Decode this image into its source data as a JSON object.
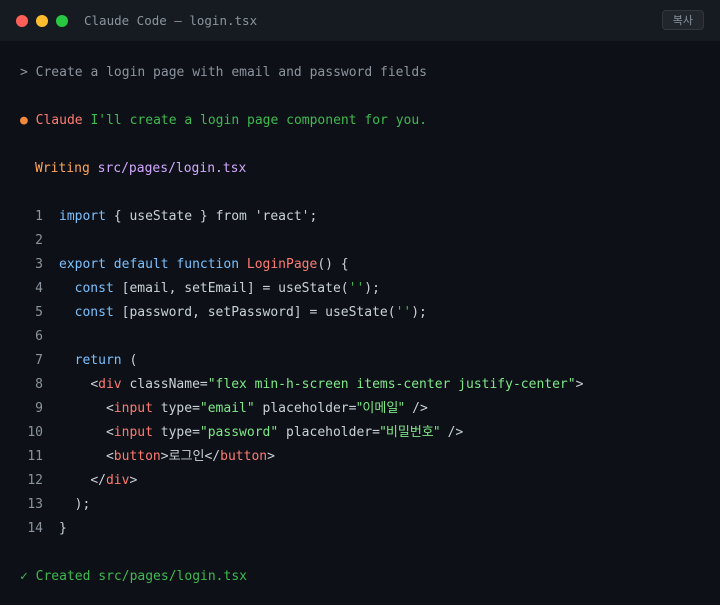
{
  "window": {
    "title": "Claude Code — login.tsx",
    "copy_label": "복사"
  },
  "conversation": {
    "prompt_caret": ">",
    "prompt_text": "Create a login page with email and password fields",
    "claude_bullet": "●",
    "claude_name": "Claude",
    "claude_message": "I'll create a login page component for you.",
    "writing_verb": "Writing",
    "writing_path": "src/pages/login.tsx",
    "created_check": "✓",
    "created_text": "Created src/pages/login.tsx"
  },
  "code": {
    "line_numbers": [
      "1",
      "2",
      "3",
      "4",
      "5",
      "6",
      "7",
      "8",
      "9",
      "10",
      "11",
      "12",
      "13",
      "14"
    ],
    "l1": {
      "kw_import": "import",
      "brace_open": " { ",
      "ident": "useState",
      "brace_close": " } ",
      "kw_from": "from",
      "sp": " ",
      "str": "'react'",
      "end": ";"
    },
    "l3": {
      "kw_export": "export",
      "kw_default": "default",
      "kw_function": "function",
      "name": "LoginPage",
      "rest": "() {"
    },
    "l4": {
      "kw_const": "const",
      "destruct": " [email, setEmail] = ",
      "call": "useState",
      "open": "(",
      "str": "''",
      "close": ");"
    },
    "l5": {
      "kw_const": "const",
      "destruct": " [password, setPassword] = ",
      "call": "useState",
      "open": "(",
      "str": "''",
      "close": ");"
    },
    "l7": {
      "kw_return": "return",
      "rest": " ("
    },
    "l8": {
      "lt": "<",
      "tag": "div",
      "attr": " className=",
      "val": "\"flex min-h-screen items-center justify-center\"",
      "gt": ">"
    },
    "l9": {
      "lt": "<",
      "tag": "input",
      "attr1": " type=",
      "val1": "\"email\"",
      "attr2": " placeholder=",
      "val2": "\"이메일\"",
      "end": " />"
    },
    "l10": {
      "lt": "<",
      "tag": "input",
      "attr1": " type=",
      "val1": "\"password\"",
      "attr2": " placeholder=",
      "val2": "\"비밀번호\"",
      "end": " />"
    },
    "l11": {
      "lt": "<",
      "tag": "button",
      "gt": ">",
      "text": "로그인",
      "close_lt": "</",
      "close_tag": "button",
      "close_gt": ">"
    },
    "l12": {
      "lt": "</",
      "tag": "div",
      "gt": ">"
    },
    "l13": {
      "text": ");"
    },
    "l14": {
      "text": "}"
    }
  }
}
